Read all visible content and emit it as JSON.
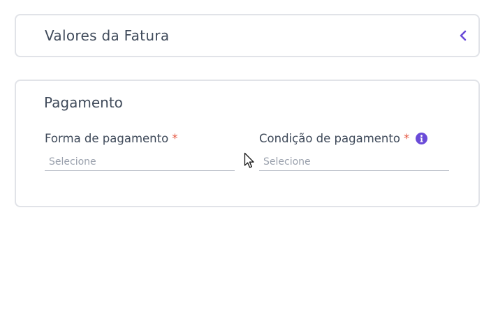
{
  "invoice_values": {
    "title": "Valores da Fatura"
  },
  "payment": {
    "title": "Pagamento",
    "payment_method": {
      "label": "Forma de pagamento",
      "required_mark": "*",
      "placeholder": "Selecione"
    },
    "payment_condition": {
      "label": "Condição de pagamento",
      "required_mark": "*",
      "placeholder": "Selecione"
    }
  },
  "colors": {
    "accent": "#6a4bd8",
    "required": "#e5533d",
    "text": "#3f4a5a",
    "border": "#e1e3e8"
  },
  "icons": {
    "collapse": "chevron-left-icon",
    "info": "info-circle-icon"
  }
}
